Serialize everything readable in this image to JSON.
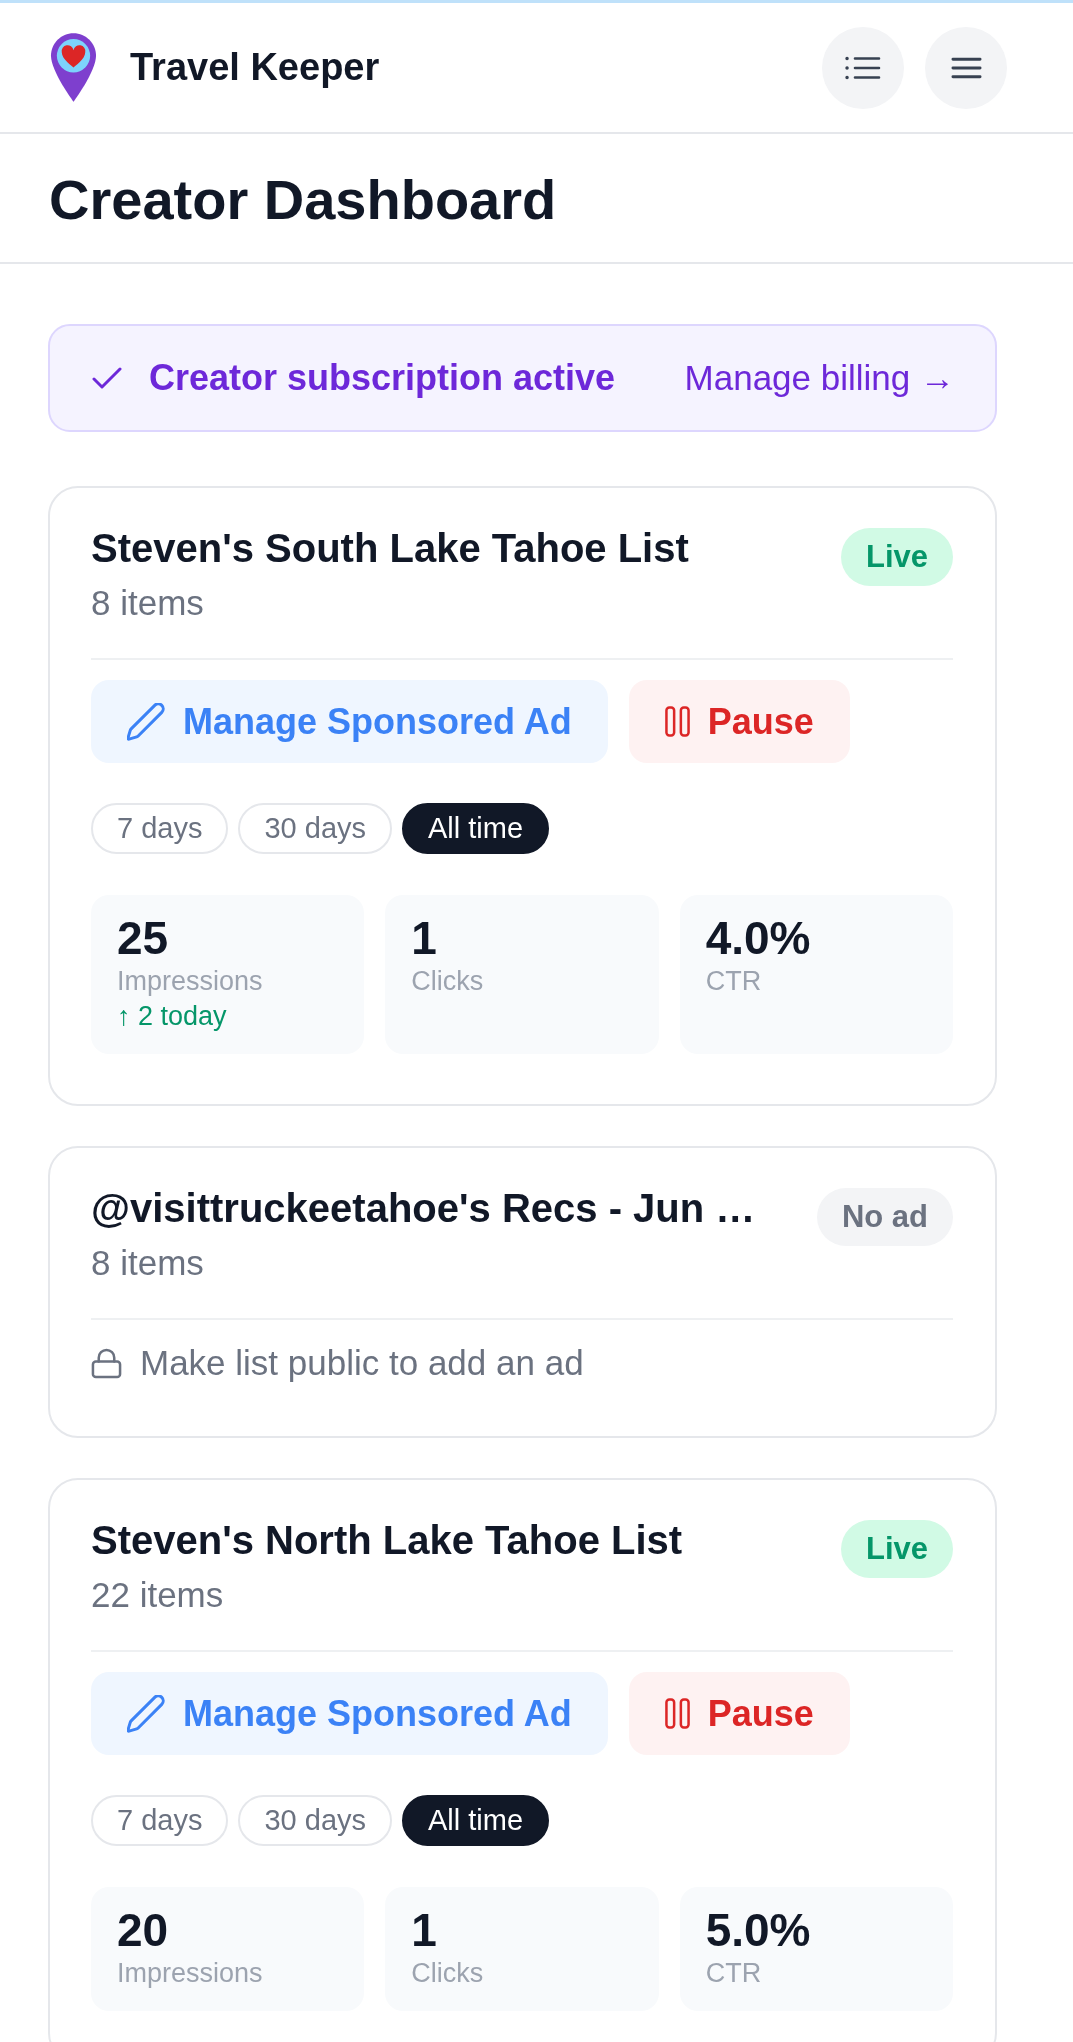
{
  "header": {
    "app_name": "Travel Keeper"
  },
  "page_title": "Creator Dashboard",
  "subscription_banner": {
    "status": "Creator subscription active",
    "link": "Manage billing →"
  },
  "lists": [
    {
      "kind": "sponsored",
      "title": "Steven's South Lake Tahoe List",
      "item_count": "8 items",
      "badge": {
        "kind": "live",
        "label": "Live"
      },
      "actions": [
        {
          "kind": "edit",
          "label": "Manage Sponsored Ad"
        },
        {
          "kind": "pause",
          "label": "Pause"
        }
      ],
      "ranges": [
        {
          "label": "7 days",
          "selected": false
        },
        {
          "label": "30 days",
          "selected": false
        },
        {
          "label": "All time",
          "selected": true
        }
      ],
      "stats": [
        {
          "value": "25",
          "label": "Impressions",
          "trend": "↑ 2 today"
        },
        {
          "value": "1",
          "label": "Clicks"
        },
        {
          "value": "4.0%",
          "label": "CTR"
        }
      ]
    },
    {
      "kind": "locked",
      "title": "@visittruckeetahoe's Recs - Jun …",
      "item_count": "8 items",
      "badge": {
        "kind": "none",
        "label": "No ad"
      },
      "notice": "Make list public to add an ad"
    },
    {
      "kind": "sponsored",
      "title": "Steven's North Lake Tahoe List",
      "item_count": "22 items",
      "badge": {
        "kind": "live",
        "label": "Live"
      },
      "actions": [
        {
          "kind": "edit",
          "label": "Manage Sponsored Ad"
        },
        {
          "kind": "pause",
          "label": "Pause"
        }
      ],
      "ranges": [
        {
          "label": "7 days",
          "selected": false
        },
        {
          "label": "30 days",
          "selected": false
        },
        {
          "label": "All time",
          "selected": true
        }
      ],
      "stats": [
        {
          "value": "20",
          "label": "Impressions"
        },
        {
          "value": "1",
          "label": "Clicks"
        },
        {
          "value": "5.0%",
          "label": "CTR"
        }
      ]
    }
  ]
}
